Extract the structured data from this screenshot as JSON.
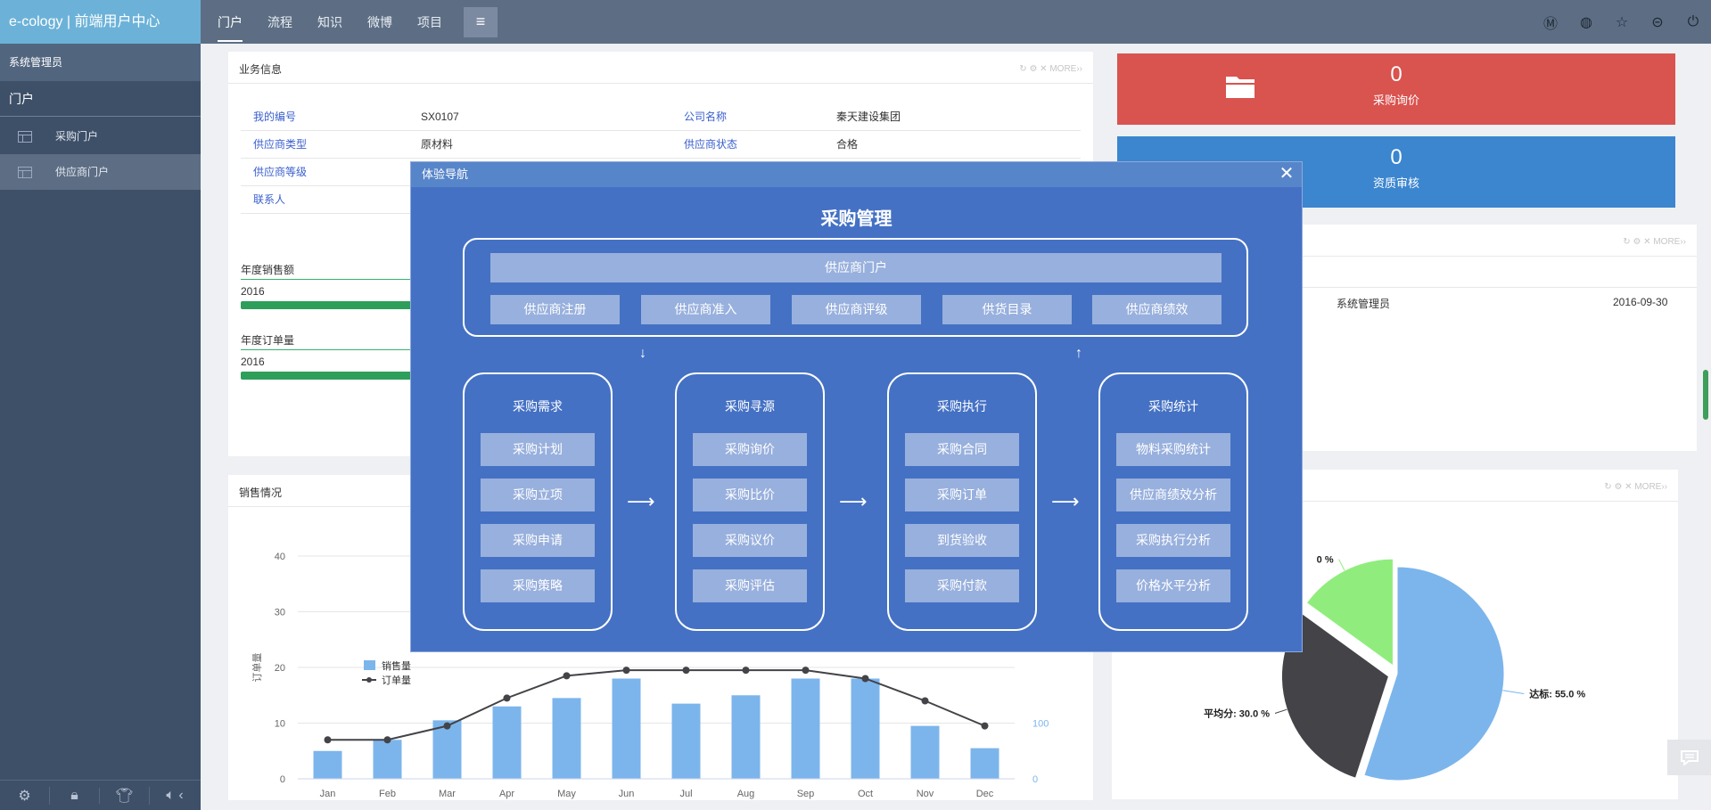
{
  "app": {
    "title": "e-cology | 前端用户中心"
  },
  "topnav": {
    "items": [
      "门户",
      "流程",
      "知识",
      "微博",
      "项目"
    ],
    "menu_icon": "hamburger-icon"
  },
  "top_icons": [
    "m-badge-icon",
    "globe-icon",
    "star-icon",
    "more-icon",
    "power-icon"
  ],
  "sidebar": {
    "user": "系统管理员",
    "section": "门户",
    "items": [
      {
        "label": "采购门户"
      },
      {
        "label": "供应商门户"
      }
    ],
    "bottom_icons": [
      "settings-icon",
      "lock-icon",
      "theme-shirt-icon",
      "speaker-icon"
    ]
  },
  "biz_card": {
    "title": "业务信息",
    "rows": [
      {
        "l1": "我的编号",
        "v1": "SX0107",
        "l2": "公司名称",
        "v2": "秦天建设集团"
      },
      {
        "l1": "供应商类型",
        "v1": "原材料",
        "l2": "供应商状态",
        "v2": "合格"
      },
      {
        "l1": "供应商等级",
        "v1": "",
        "l2": "",
        "v2": ""
      },
      {
        "l1": "联系人",
        "v1": "",
        "l2": "",
        "v2": ""
      }
    ],
    "annual_sales": {
      "title": "年度销售额",
      "year": "2016"
    },
    "annual_orders": {
      "title": "年度订单量",
      "year": "2016"
    }
  },
  "sales_card": {
    "title": "销售情况"
  },
  "tiles": [
    {
      "count": "0",
      "label": "采购询价",
      "color": "#d9534f"
    },
    {
      "count": "0",
      "label": "资质审核",
      "color": "#3b86cf"
    }
  ],
  "notice_card": {
    "name": "系统管理员",
    "date": "2016-09-30"
  },
  "chart_data": [
    {
      "type": "bar",
      "categories": [
        "Jan",
        "Feb",
        "Mar",
        "Apr",
        "May",
        "Jun",
        "Jul",
        "Aug",
        "Sep",
        "Oct",
        "Nov",
        "Dec"
      ],
      "ylabel": "订单量",
      "ylim": [
        0,
        40
      ],
      "yticks": [
        0,
        10,
        20,
        30,
        40
      ],
      "y2ticks": [
        "0",
        "100"
      ],
      "legend": [
        "销售量",
        "订单量"
      ],
      "series": [
        {
          "name": "销售量",
          "type": "bar",
          "values": [
            5,
            7,
            10.5,
            13,
            14.5,
            18,
            13.5,
            15,
            18,
            18,
            9.5,
            5.5
          ]
        },
        {
          "name": "订单量",
          "type": "line",
          "values": [
            7,
            7,
            9.5,
            14.5,
            18.5,
            19.5,
            19.5,
            19.5,
            19.5,
            18,
            14,
            9.5
          ]
        }
      ]
    },
    {
      "type": "pie",
      "labels": [
        "达标",
        "平均分",
        ""
      ],
      "label_texts": [
        "达标: 55.0 %",
        "平均分: 30.0 %",
        "0 %"
      ],
      "values": [
        55,
        30,
        15
      ],
      "colors": [
        "#7cb5ec",
        "#434348",
        "#90ed7d"
      ]
    }
  ],
  "modal": {
    "header": "体验导航",
    "title": "采购管理",
    "portal": "供应商门户",
    "portal_items": [
      "供应商注册",
      "供应商准入",
      "供应商评级",
      "供货目录",
      "供应商绩效"
    ],
    "columns": [
      {
        "title": "采购需求",
        "items": [
          "采购计划",
          "采购立项",
          "采购申请",
          "采购策略"
        ]
      },
      {
        "title": "采购寻源",
        "items": [
          "采购询价",
          "采购比价",
          "采购议价",
          "采购评估"
        ]
      },
      {
        "title": "采购执行",
        "items": [
          "采购合同",
          "采购订单",
          "到货验收",
          "采购付款"
        ]
      },
      {
        "title": "采购统计",
        "items": [
          "物料采购统计",
          "供应商绩效分析",
          "采购执行分析",
          "价格水平分析"
        ]
      }
    ]
  }
}
